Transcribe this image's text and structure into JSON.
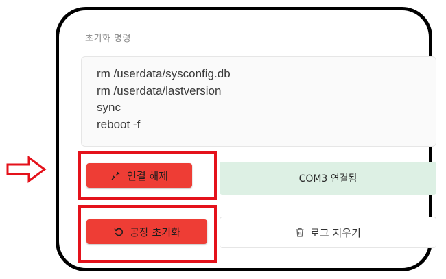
{
  "panel": {
    "section_label": "초기화 명령",
    "commands": [
      "rm /userdata/sysconfig.db",
      "rm /userdata/lastversion",
      "sync",
      "reboot -f"
    ]
  },
  "buttons": {
    "disconnect_label": "연결 해제",
    "disconnect_icon": "unlink-icon",
    "factory_reset_label": "공장 초기화",
    "factory_reset_icon": "undo-icon",
    "clear_log_label": "로그 지우기",
    "clear_log_icon": "trash-icon"
  },
  "status": {
    "connection_text": "COM3 연결됨"
  },
  "colors": {
    "danger": "#ee3d35",
    "success_bg": "#ddf0e4",
    "highlight": "#e4121b"
  }
}
